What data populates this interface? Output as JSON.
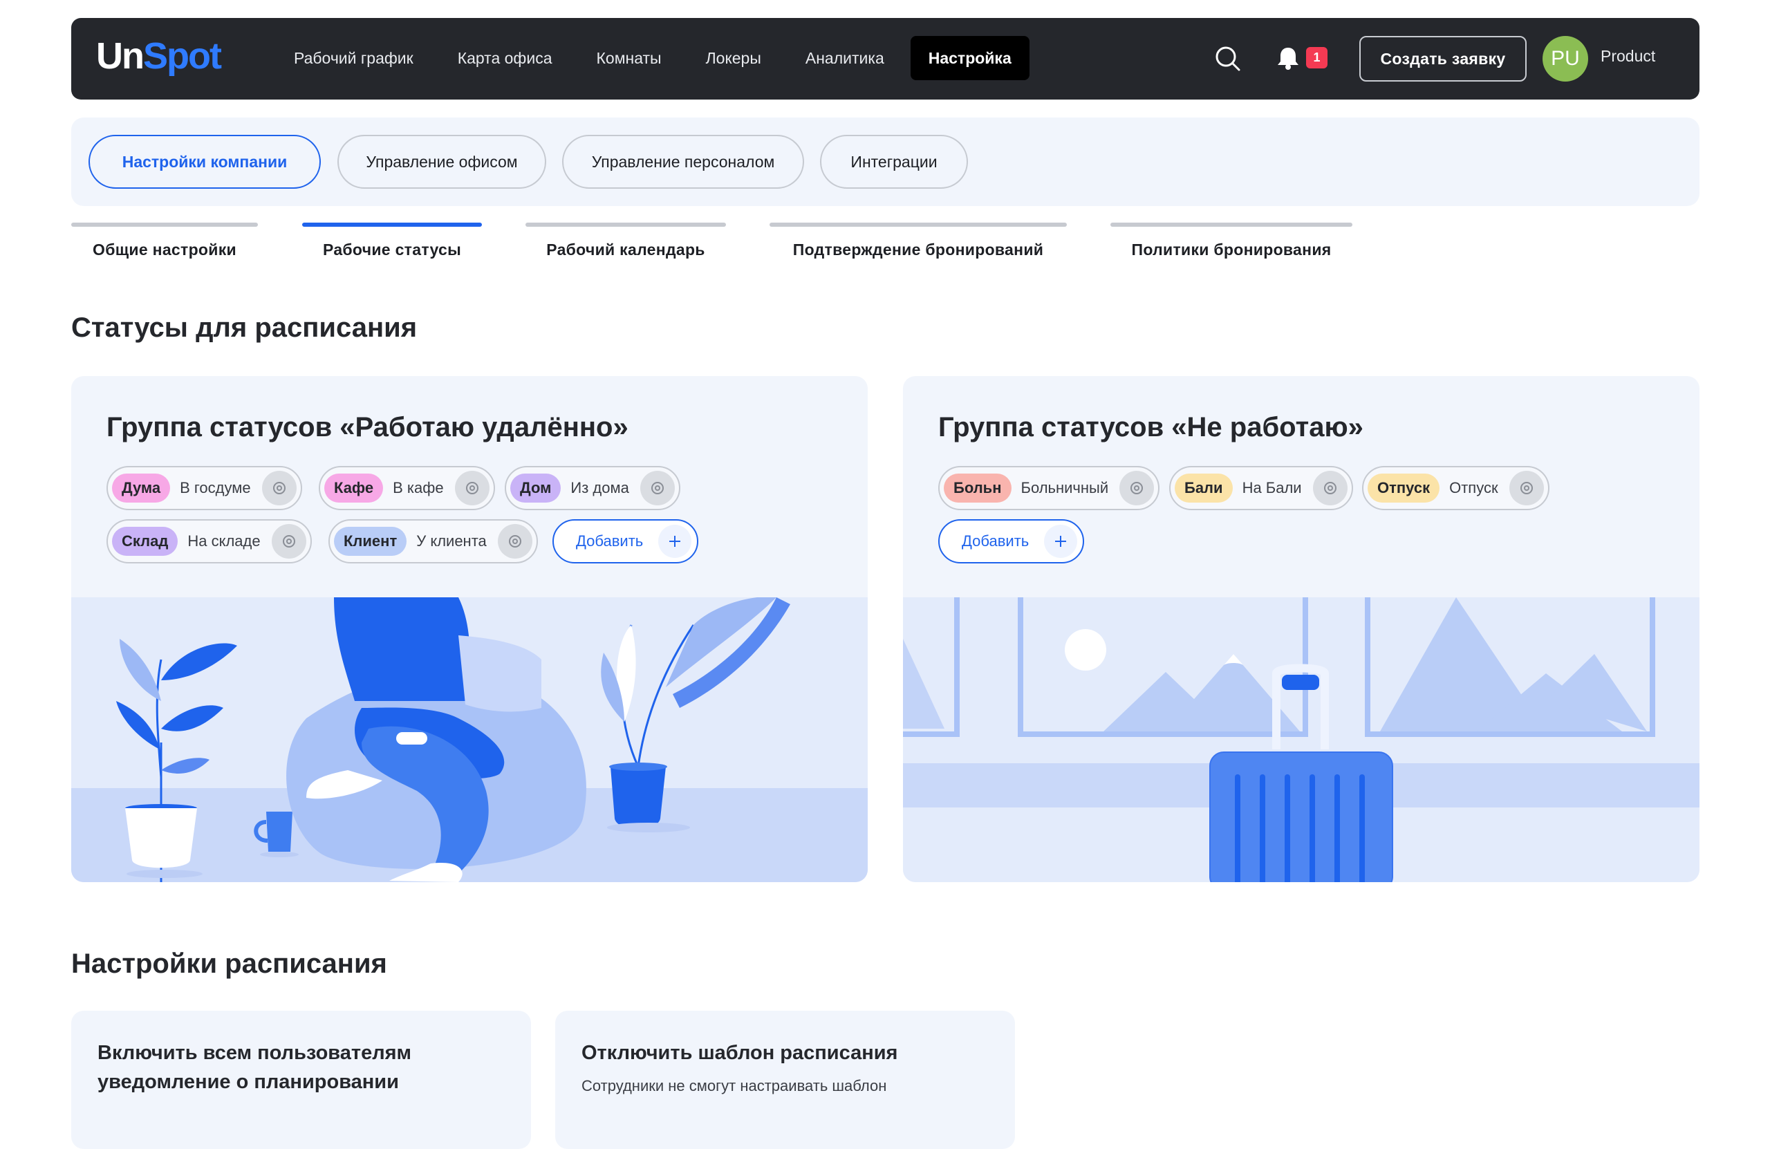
{
  "app": {
    "logo_un": "Un",
    "logo_spot": "Spot"
  },
  "nav": {
    "items": [
      {
        "label": "Рабочий график"
      },
      {
        "label": "Карта офиса"
      },
      {
        "label": "Комнаты"
      },
      {
        "label": "Локеры"
      },
      {
        "label": "Аналитика"
      },
      {
        "label": "Настройка",
        "active": true
      }
    ],
    "search_icon": "search-icon",
    "bell_icon": "bell-icon",
    "notification_count": "1",
    "create_button": "Создать заявку",
    "avatar_initials": "PU",
    "user_name": "Product"
  },
  "categories": [
    {
      "label": "Настройки компании",
      "active": true
    },
    {
      "label": "Управление офисом"
    },
    {
      "label": "Управление персоналом"
    },
    {
      "label": "Интеграции"
    }
  ],
  "subtabs": [
    {
      "label": "Общие настройки"
    },
    {
      "label": "Рабочие статусы",
      "active": true
    },
    {
      "label": "Рабочий календарь"
    },
    {
      "label": "Подтверждение бронирований"
    },
    {
      "label": "Политики бронирования"
    }
  ],
  "statuses_section": {
    "title": "Статусы для расписания",
    "groups": [
      {
        "title": "Группа статусов «Работаю удалённо»",
        "statuses": [
          {
            "tag": "Дума",
            "name": "В госдуме",
            "color": "#f7a8e6"
          },
          {
            "tag": "Кафе",
            "name": "В кафе",
            "color": "#f7a8e6"
          },
          {
            "tag": "Дом",
            "name": "Из дома",
            "color": "#c9b3f7"
          },
          {
            "tag": "Склад",
            "name": "На складе",
            "color": "#c9b3f7"
          },
          {
            "tag": "Клиент",
            "name": "У клиента",
            "color": "#b9cdf7"
          }
        ],
        "add_label": "Добавить",
        "illustration": "person-working-remotely"
      },
      {
        "title": "Группа статусов «Не работаю»",
        "statuses": [
          {
            "tag": "Больн",
            "name": "Больничный",
            "color": "#f9b4ae"
          },
          {
            "tag": "Бали",
            "name": "На Бали",
            "color": "#fbe3a8"
          },
          {
            "tag": "Отпуск",
            "name": "Отпуск",
            "color": "#fbe3a8"
          }
        ],
        "add_label": "Добавить",
        "illustration": "suitcase-travel"
      }
    ]
  },
  "schedule_section": {
    "title": "Настройки расписания",
    "cards": [
      {
        "title_line1": "Включить всем пользователям",
        "title_line2": "уведомление о планировании",
        "desc": ""
      },
      {
        "title_line1": "Отключить шаблон расписания",
        "title_line2": "",
        "desc": "Сотрудники не смогут настраивать шаблон"
      }
    ]
  },
  "colors": {
    "accent": "#1f63ec",
    "topbar": "#25272c",
    "badge": "#f43a53",
    "avatar": "#8bbd53",
    "card_bg": "#f1f5fc"
  }
}
